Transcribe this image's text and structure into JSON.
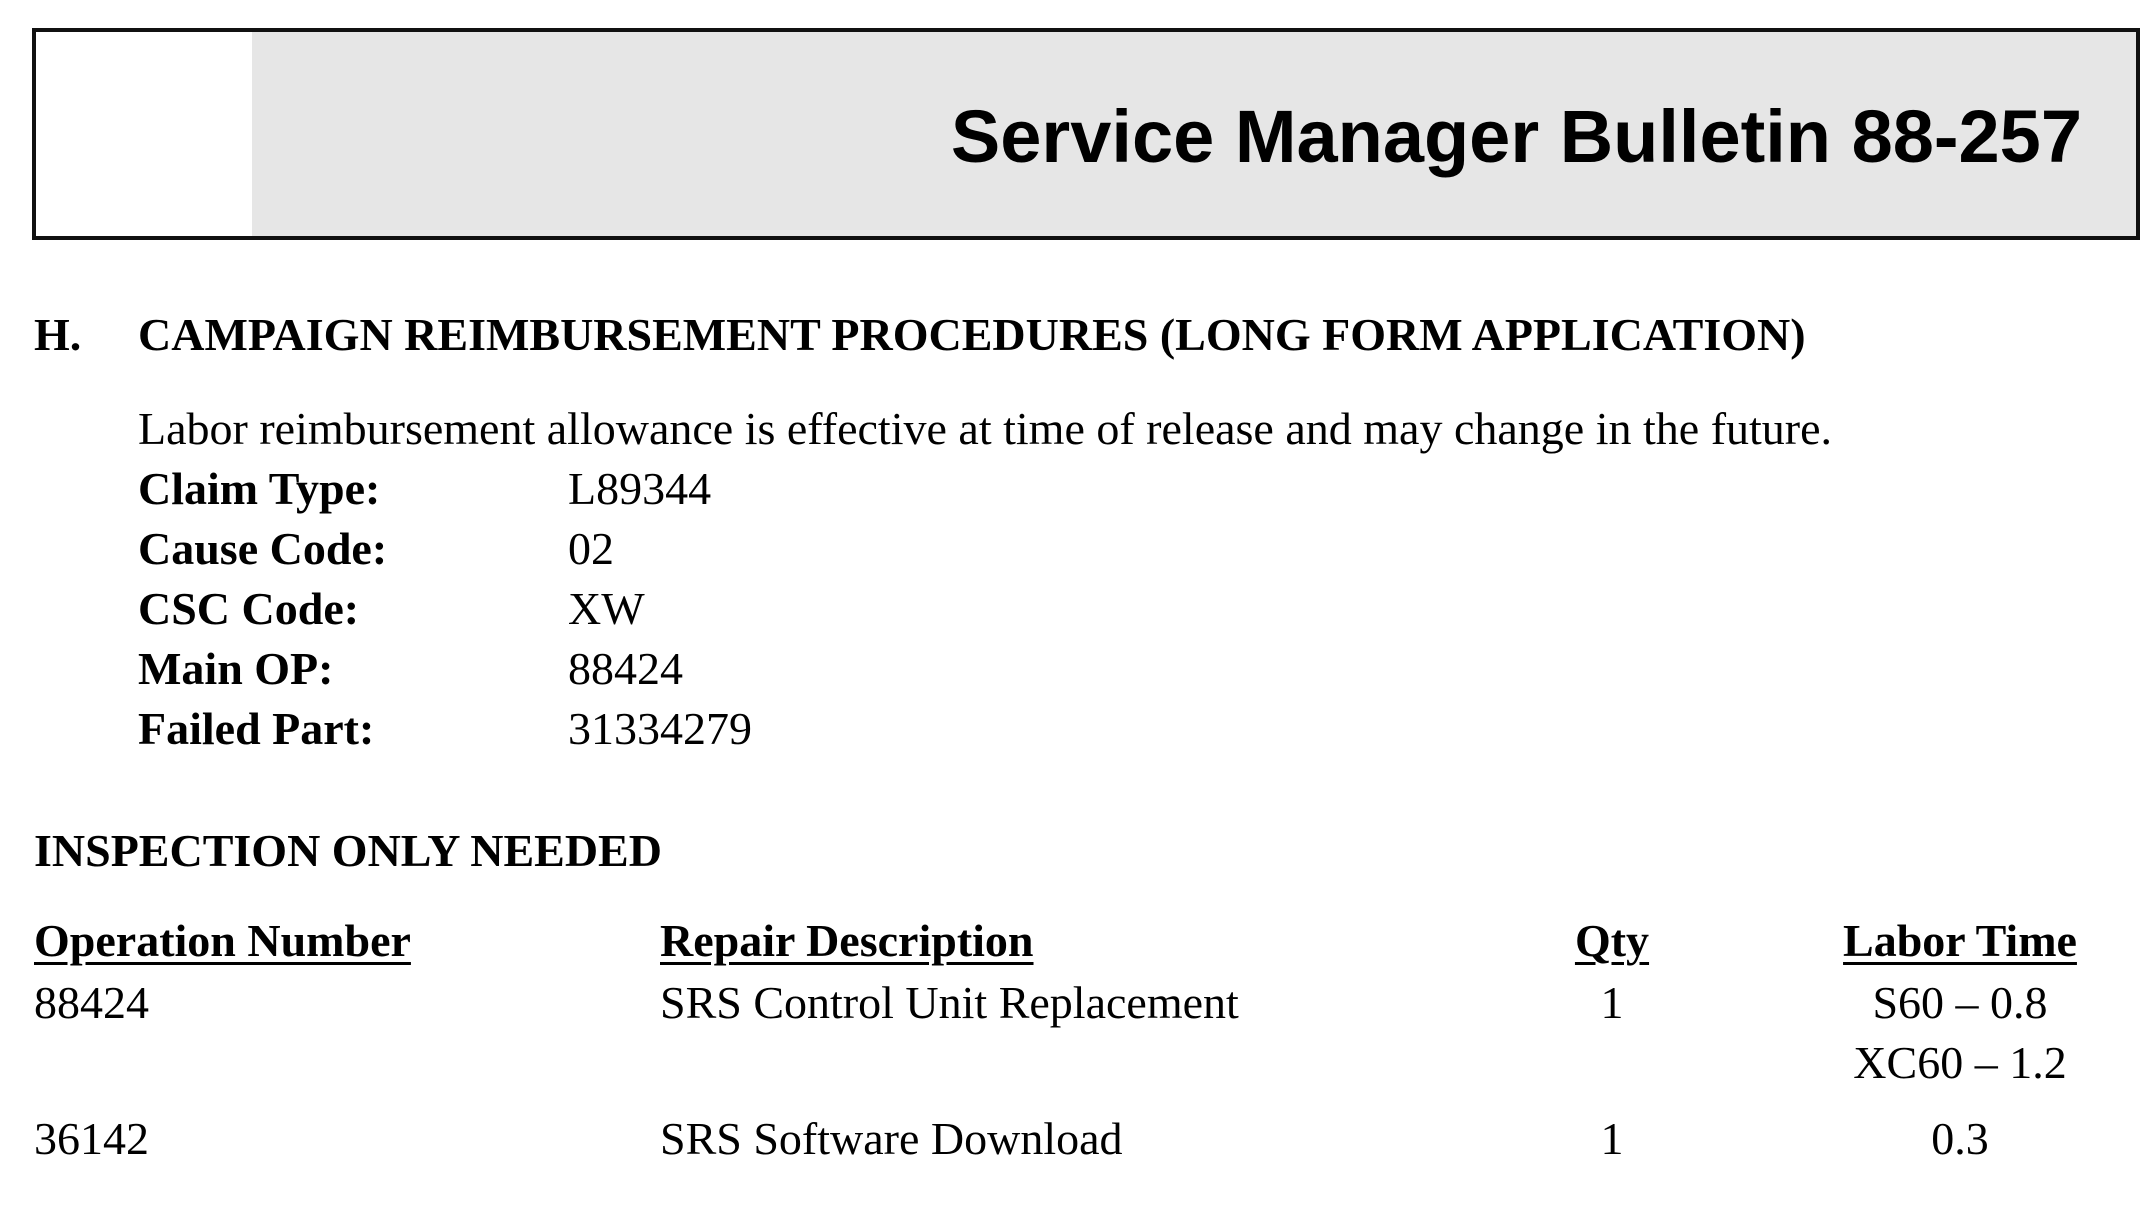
{
  "header": {
    "title": "Service Manager Bulletin 88-257"
  },
  "section": {
    "letter": "H.",
    "heading": "CAMPAIGN REIMBURSEMENT PROCEDURES (LONG FORM APPLICATION)",
    "intro": "Labor reimbursement allowance is effective at time of release and may change in the future."
  },
  "fields": [
    {
      "label": "Claim Type:",
      "value": "L89344"
    },
    {
      "label": "Cause Code:",
      "value": "02"
    },
    {
      "label": "CSC Code:",
      "value": "XW"
    },
    {
      "label": "Main OP:",
      "value": "88424"
    },
    {
      "label": "Failed Part:",
      "value": "31334279"
    }
  ],
  "inspection": {
    "heading": "INSPECTION ONLY NEEDED",
    "columns": {
      "operation": "Operation Number",
      "description": "Repair Description",
      "qty": "Qty",
      "labor": "Labor Time"
    },
    "rows": [
      {
        "operation": "88424",
        "description": "SRS Control Unit Replacement",
        "qty": "1",
        "labor": [
          "S60 – 0.8",
          "XC60 – 1.2"
        ]
      },
      {
        "operation": "36142",
        "description": "SRS Software Download",
        "qty": "1",
        "labor": [
          "0.3"
        ]
      }
    ]
  }
}
